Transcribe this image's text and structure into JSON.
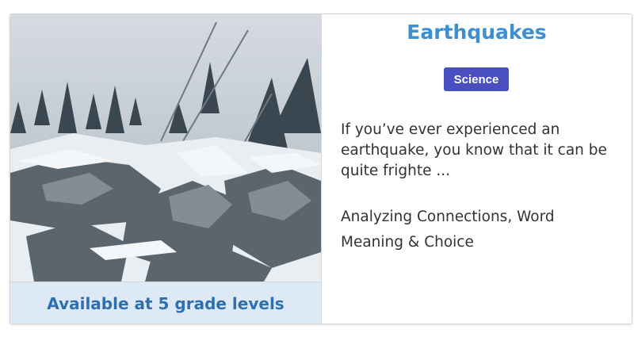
{
  "card": {
    "title": "Earthquakes",
    "subject_badge": "Science",
    "summary": "If you’ve ever experienced an earthquake, you know that it can be quite frighte ...",
    "skills": "Analyzing Connections, Word Meaning & Choice",
    "grade_levels_label": "Available at 5 grade levels",
    "image_description_icon": "earthquake-photo",
    "colors": {
      "title": "#3d8fd0",
      "badge_bg": "#4a4fbf",
      "grade_bar_bg": "#dde9f5",
      "grade_text": "#2f6fb0"
    }
  }
}
